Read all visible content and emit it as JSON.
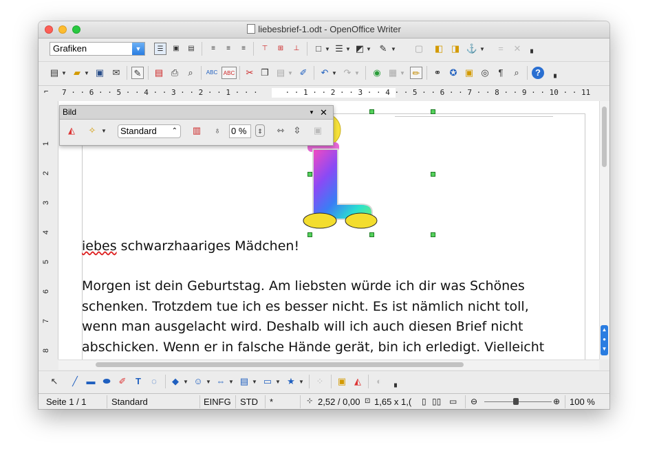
{
  "window": {
    "title": "liebesbrief-1.odt - OpenOffice Writer"
  },
  "formatting_toolbar": {
    "paragraph_style": "Grafiken",
    "icons": [
      "wrap-off-icon",
      "wrap-page-icon",
      "wrap-through-icon",
      "align-left-icon",
      "align-center-icon",
      "align-right-icon",
      "align-top-icon",
      "align-middle-icon",
      "align-bottom-icon",
      "borders-icon",
      "line-style-icon",
      "border-color-icon",
      "background-color-icon",
      "bring-to-front-icon",
      "send-to-back-icon",
      "anchor-icon"
    ]
  },
  "standard_toolbar": {
    "icons": [
      "new-icon",
      "open-icon",
      "save-icon",
      "email-icon",
      "edit-file-icon",
      "export-pdf-icon",
      "print-icon",
      "page-preview-icon",
      "spellcheck-icon",
      "autospellcheck-icon",
      "cut-icon",
      "copy-icon",
      "paste-icon",
      "format-paintbrush-icon",
      "undo-icon",
      "redo-icon",
      "hyperlink-icon",
      "table-icon",
      "show-draw-functions-icon",
      "find-replace-icon",
      "navigator-icon",
      "gallery-icon",
      "data-sources-icon",
      "formatting-marks-icon",
      "zoom-icon",
      "help-icon"
    ]
  },
  "ruler": {
    "text": "7 · · 6 · · 5 · · 4 · · 3 · · 2 · · 1 · · ·      · · 1 · · 2 · · 3 · · 4 · · 5 · · 6 · · 7 · · 8 · · 9 · · 10 · · 11"
  },
  "vertical_ruler": [
    "1",
    "2",
    "3",
    "4",
    "5",
    "6",
    "7",
    "8"
  ],
  "picture_toolbar": {
    "title": "Bild",
    "graphics_mode": "Standard",
    "transparency": "0 %"
  },
  "document": {
    "greeting": "iebes schwarzhaariges Mädchen!",
    "lines": [
      "Morgen ist dein Geburtstag. Am liebsten würde ich dir was Schönes",
      "schenken. Trotzdem tue ich es besser nicht. Es ist nämlich nicht toll,",
      "wenn man ausgelacht wird. Deshalb will ich auch diesen Brief nicht",
      "abschicken. Wenn er in falsche Hände gerät, bin ich erledigt. Vielleicht"
    ]
  },
  "status_bar": {
    "page": "Seite 1 / 1",
    "page_style": "Standard",
    "insert_mode": "EINFG",
    "selection_mode": "STD",
    "modified": "*",
    "position": "2,52 / 0,00",
    "size": "1,65 x 1,(",
    "zoom": "100 %",
    "zoom_level": 100
  }
}
